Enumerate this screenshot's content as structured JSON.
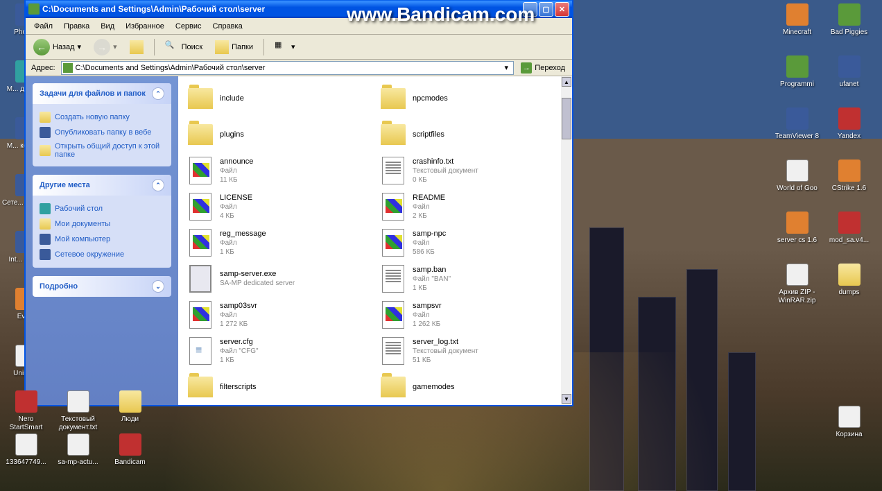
{
  "watermark": "www.Bandicam.com",
  "window": {
    "title": "C:\\Documents and Settings\\Admin\\Рабочий стол\\server"
  },
  "menu": {
    "file": "Файл",
    "edit": "Правка",
    "view": "Вид",
    "favorites": "Избранное",
    "tools": "Сервис",
    "help": "Справка"
  },
  "toolbar": {
    "back": "Назад",
    "search": "Поиск",
    "folders": "Папки"
  },
  "address": {
    "label": "Адрес:",
    "value": "C:\\Documents and Settings\\Admin\\Рабочий стол\\server",
    "go": "Переход"
  },
  "sidebar": {
    "tasks": {
      "title": "Задачи для файлов и папок",
      "new_folder": "Создать новую папку",
      "publish": "Опубликовать папку в вебе",
      "share": "Открыть общий доступ к этой папке"
    },
    "places": {
      "title": "Другие места",
      "desktop": "Рабочий стол",
      "my_docs": "Мои документы",
      "my_computer": "Мой компьютер",
      "network": "Сетевое окружение"
    },
    "details": {
      "title": "Подробно"
    }
  },
  "files": [
    {
      "name": "include",
      "type": "folder"
    },
    {
      "name": "npcmodes",
      "type": "folder"
    },
    {
      "name": "plugins",
      "type": "folder"
    },
    {
      "name": "scriptfiles",
      "type": "folder"
    },
    {
      "name": "announce",
      "meta1": "Файл",
      "meta2": "11 КБ",
      "icon": "win"
    },
    {
      "name": "crashinfo.txt",
      "meta1": "Текстовый документ",
      "meta2": "0 КБ",
      "icon": "txt"
    },
    {
      "name": "LICENSE",
      "meta1": "Файл",
      "meta2": "4 КБ",
      "icon": "win"
    },
    {
      "name": "README",
      "meta1": "Файл",
      "meta2": "2 КБ",
      "icon": "win"
    },
    {
      "name": "reg_message",
      "meta1": "Файл",
      "meta2": "1 КБ",
      "icon": "win"
    },
    {
      "name": "samp-npc",
      "meta1": "Файл",
      "meta2": "586 КБ",
      "icon": "win"
    },
    {
      "name": "samp-server.exe",
      "meta1": "SA-MP dedicated server",
      "meta2": "",
      "icon": "exe"
    },
    {
      "name": "samp.ban",
      "meta1": "Файл \"BAN\"",
      "meta2": "1 КБ",
      "icon": "txt"
    },
    {
      "name": "samp03svr",
      "meta1": "Файл",
      "meta2": "1 272 КБ",
      "icon": "win"
    },
    {
      "name": "sampsvr",
      "meta1": "Файл",
      "meta2": "1 262 КБ",
      "icon": "win"
    },
    {
      "name": "server.cfg",
      "meta1": "Файл \"CFG\"",
      "meta2": "1 КБ",
      "icon": "cfg"
    },
    {
      "name": "server_log.txt",
      "meta1": "Текстовый документ",
      "meta2": "51 КБ",
      "icon": "txt"
    },
    {
      "name": "filterscripts",
      "type": "folder"
    },
    {
      "name": "gamemodes",
      "type": "folder"
    }
  ],
  "desktop_left": [
    {
      "label": "Photo..."
    },
    {
      "label": "М... докум..."
    },
    {
      "label": "М... компь..."
    },
    {
      "label": "Сете... окруж..."
    },
    {
      "label": "Int... Expl..."
    },
    {
      "label": "Eve..."
    },
    {
      "label": "Uninst..."
    },
    {
      "label": "Nero StartSmart"
    },
    {
      "label": "Текстовый документ.txt"
    },
    {
      "label": "Люди"
    }
  ],
  "desktop_bottom": [
    {
      "label": "133647749..."
    },
    {
      "label": "sa-mp-actu..."
    },
    {
      "label": "Bandicam"
    }
  ],
  "desktop_right": [
    [
      {
        "label": "Minecraft"
      },
      {
        "label": "Bad Piggies"
      }
    ],
    [
      {
        "label": "Programmi"
      },
      {
        "label": "ufanet"
      }
    ],
    [
      {
        "label": "TeamViewer 8"
      },
      {
        "label": "Yandex"
      }
    ],
    [
      {
        "label": "World of Goo"
      },
      {
        "label": "CStrike 1.6"
      }
    ],
    [
      {
        "label": "server cs 1.6"
      },
      {
        "label": "mod_sa.v4..."
      }
    ],
    [
      {
        "label": "Архив ZIP - WinRAR.zip"
      },
      {
        "label": "dumps"
      }
    ],
    [
      {
        "label": ""
      },
      {
        "label": "Корзина"
      }
    ]
  ]
}
